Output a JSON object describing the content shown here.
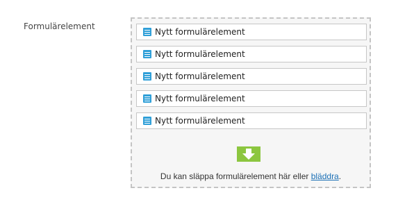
{
  "field": {
    "label": "Formulärelement"
  },
  "items": [
    {
      "label": "Nytt formulärelement",
      "icon": "form-element-icon"
    },
    {
      "label": "Nytt formulärelement",
      "icon": "form-element-icon"
    },
    {
      "label": "Nytt formulärelement",
      "icon": "form-element-icon"
    },
    {
      "label": "Nytt formulärelement",
      "icon": "form-element-icon"
    },
    {
      "label": "Nytt formulärelement",
      "icon": "form-element-icon"
    }
  ],
  "dropzone": {
    "icon": "download-arrow-icon",
    "hint_prefix": "Du kan släppa formulärelement här eller ",
    "browse_link": "bläddra",
    "hint_suffix": "."
  },
  "colors": {
    "item_icon": "#2f9fd8",
    "drop_arrow": "#8cc63f",
    "link": "#1a6fb5"
  }
}
